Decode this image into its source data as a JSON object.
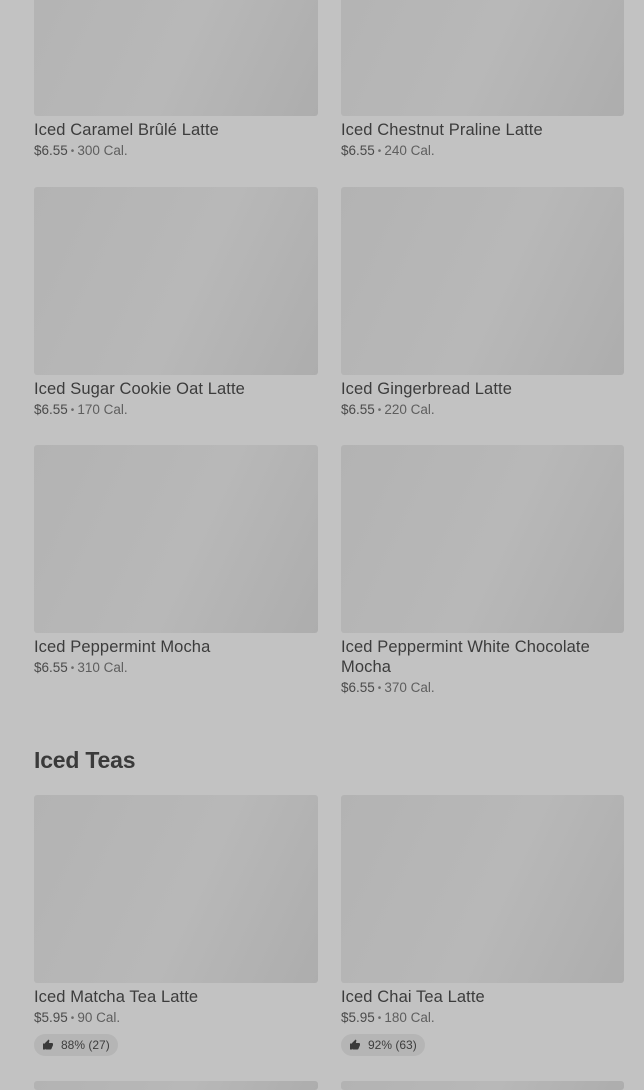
{
  "items": [
    {
      "name": "Iced Caramel Brûlé Latte",
      "price": "$6.55",
      "cal": "300 Cal."
    },
    {
      "name": "Iced Chestnut Praline Latte",
      "price": "$6.55",
      "cal": "240 Cal."
    },
    {
      "name": "Iced Sugar Cookie Oat Latte",
      "price": "$6.55",
      "cal": "170 Cal."
    },
    {
      "name": "Iced Gingerbread Latte",
      "price": "$6.55",
      "cal": "220 Cal."
    },
    {
      "name": "Iced Peppermint Mocha",
      "price": "$6.55",
      "cal": "310 Cal."
    },
    {
      "name": "Iced Peppermint White Chocolate Mocha",
      "price": "$6.55",
      "cal": "370 Cal."
    }
  ],
  "section": {
    "title": "Iced Teas"
  },
  "teas": [
    {
      "name": "Iced Matcha Tea Latte",
      "price": "$5.95",
      "cal": "90 Cal.",
      "rating": "88% (27)"
    },
    {
      "name": "Iced Chai Tea Latte",
      "price": "$5.95",
      "cal": "180 Cal.",
      "rating": "92% (63)"
    }
  ],
  "separator": "•",
  "icons": {
    "rating": "thumbs-up-icon"
  }
}
